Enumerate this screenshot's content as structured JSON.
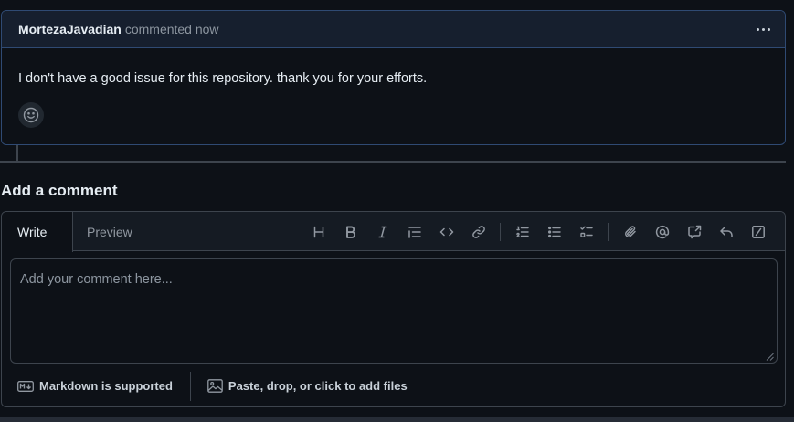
{
  "comment": {
    "author": "MortezaJavadian",
    "meta": "commented now",
    "body": "I don't have a good issue for this repository. thank you for your efforts.",
    "menu_icon": "kebab-horizontal-icon",
    "reaction_icon": "smiley-icon"
  },
  "add_comment": {
    "heading": "Add a comment",
    "tabs": [
      {
        "label": "Write",
        "active": true
      },
      {
        "label": "Preview",
        "active": false
      }
    ],
    "toolbar": [
      "heading-icon",
      "bold-icon",
      "italic-icon",
      "quote-icon",
      "code-icon",
      "link-icon",
      "ordered-list-icon",
      "unordered-list-icon",
      "task-list-icon",
      "attach-icon",
      "mention-icon",
      "cross-reference-icon",
      "saved-reply-icon",
      "slash-commands-icon"
    ],
    "placeholder": "Add your comment here...",
    "value": "",
    "footer": {
      "markdown_label": "Markdown is supported",
      "attach_label": "Paste, drop, or click to add files"
    }
  },
  "colors": {
    "background": "#0d1117",
    "comment_border": "#2f4a73",
    "comment_header": "#161f2e",
    "border": "#3d444d",
    "muted_text": "#8d96a0"
  }
}
